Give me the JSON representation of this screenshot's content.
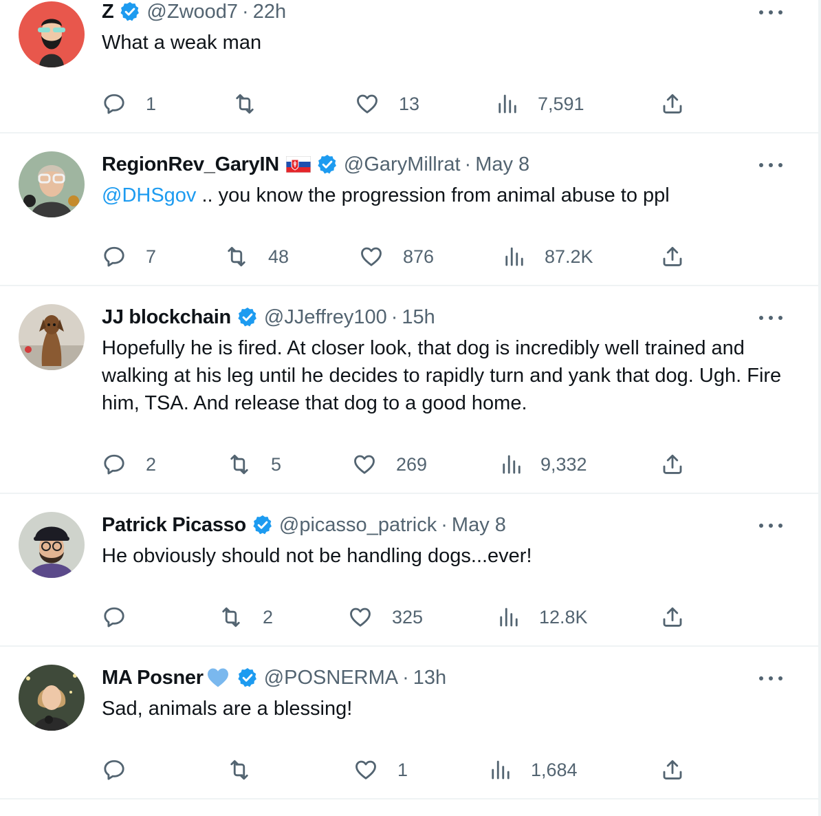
{
  "tweets": [
    {
      "name": "Z",
      "handle": "@Zwood7",
      "separator": "·",
      "time": "22h",
      "mention": "",
      "text": "What a weak man",
      "stats": {
        "replies": "1",
        "reposts": "",
        "likes": "13",
        "views": "7,591"
      }
    },
    {
      "name": "RegionRev_GaryIN",
      "handle": "@GaryMillrat",
      "separator": "·",
      "time": "May 8",
      "mention": "@DHSgov",
      "text": " .. you know the progression from animal abuse to ppl",
      "stats": {
        "replies": "7",
        "reposts": "48",
        "likes": "876",
        "views": "87.2K"
      }
    },
    {
      "name": "JJ blockchain",
      "handle": "@JJeffrey100",
      "separator": "·",
      "time": "15h",
      "mention": "",
      "text": "Hopefully he is fired. At closer look, that dog is incredibly well trained and walking at his leg until he decides to rapidly turn and yank that dog. Ugh. Fire him, TSA. And release that dog to a good home.",
      "stats": {
        "replies": "2",
        "reposts": "5",
        "likes": "269",
        "views": "9,332"
      }
    },
    {
      "name": "Patrick Picasso",
      "handle": "@picasso_patrick",
      "separator": "·",
      "time": "May 8",
      "mention": "",
      "text": "He obviously should not be handling dogs...ever!",
      "stats": {
        "replies": "",
        "reposts": "2",
        "likes": "325",
        "views": "12.8K"
      }
    },
    {
      "name": "MA Posner",
      "handle": "@POSNERMA",
      "separator": "·",
      "time": "13h",
      "mention": "",
      "text": "Sad, animals are a blessing!",
      "stats": {
        "replies": "",
        "reposts": "",
        "likes": "1",
        "views": "1,684"
      }
    }
  ],
  "colors": {
    "accent": "#1d9bf0",
    "text": "#0f1419",
    "secondary": "#536471",
    "divider": "#eff3f4"
  },
  "icons": {
    "reply": "reply-icon",
    "repost": "repost-icon",
    "like": "heart-icon",
    "views": "views-icon",
    "share": "share-icon",
    "verified": "verified-badge-icon",
    "more": "more-options-icon"
  }
}
